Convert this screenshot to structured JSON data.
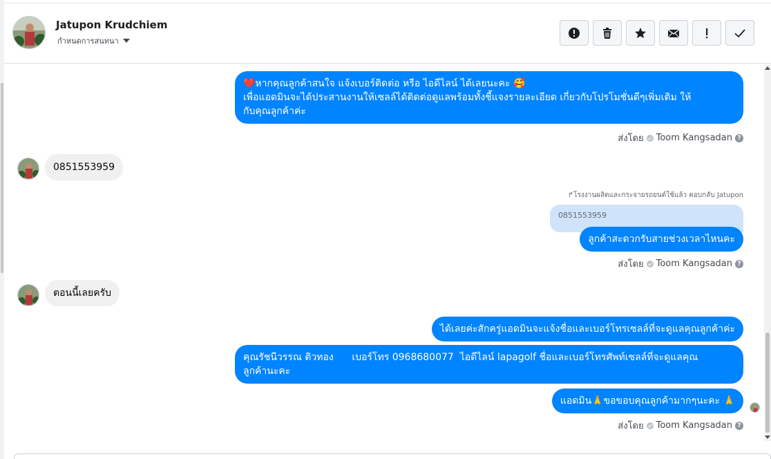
{
  "header": {
    "contact_name": "Jatupon Krudchiem",
    "label_dropdown": "กำหนดการสนทนา",
    "actions": [
      {
        "name": "mark-spam-button",
        "icon": "alert-circle-icon"
      },
      {
        "name": "delete-button",
        "icon": "trash-icon"
      },
      {
        "name": "star-button",
        "icon": "star-icon"
      },
      {
        "name": "mark-unread-button",
        "icon": "envelope-icon"
      },
      {
        "name": "follow-up-button",
        "icon": "exclamation-icon"
      },
      {
        "name": "mark-done-button",
        "icon": "check-icon"
      }
    ]
  },
  "messages": {
    "m1": {
      "line1": "❤️หากคุณลูกค้าสนใจ แจ้งเบอร์ติดต่อ หรือ ไอดีไลน์ ได้เลยนะคะ 🥰",
      "line2": "เพื่อแอดมินจะได้ประสานงานให้เซลล์ได้ติดต่อดูแลพร้อมทั้งชี้แจงรายละเอียด เกี่ยวกับโปรโมชั่นดีๆเพิ่มเติม ให้",
      "line3": "กับคุณลูกค้าค่ะ"
    },
    "sent_by_1": "ส่งโดย",
    "sender_1": "Toom Kangsadan",
    "m2": "0851553959",
    "reply_note": "↱โรงงานผลิตและกระจายรถยนต์ใช้แล้ว ตอบกลับ Jatupon",
    "reply_quote": "0851553959",
    "m3": "ลูกค้าสะดวกรับสายช่วงเวลาไหนคะ",
    "sent_by_2": "ส่งโดย",
    "sender_2": "Toom Kangsadan",
    "m4": "ตอนนี้เลยครับ",
    "m5": "ได้เลยค่ะสักครู่แอดมินจะแจ้งชื่อและเบอร์โทรเซลล์ที่จะดูแลคุณลูกค้าค่ะ",
    "m6": {
      "line1": "คุณรัชนีวรรณ ติวทอง      เบอร์โทร 0968680077  ไอดีไลน์ lapagolf ชื่อและเบอร์โทรศัพท์เซลล์ที่จะดูแลคุณ",
      "line2": "ลูกค้านะคะ"
    },
    "m7": "แอดมิน🙏ขอขอบคุณลูกค้ามากๆนะคะ 🙏",
    "sent_by_3": "ส่งโดย",
    "sender_3": "Toom Kangsadan",
    "help": "?"
  },
  "colors": {
    "outgoing_bubble": "#0084ff",
    "incoming_bubble": "#f0f0f0",
    "reply_quote_bg": "#cfe3fb"
  }
}
